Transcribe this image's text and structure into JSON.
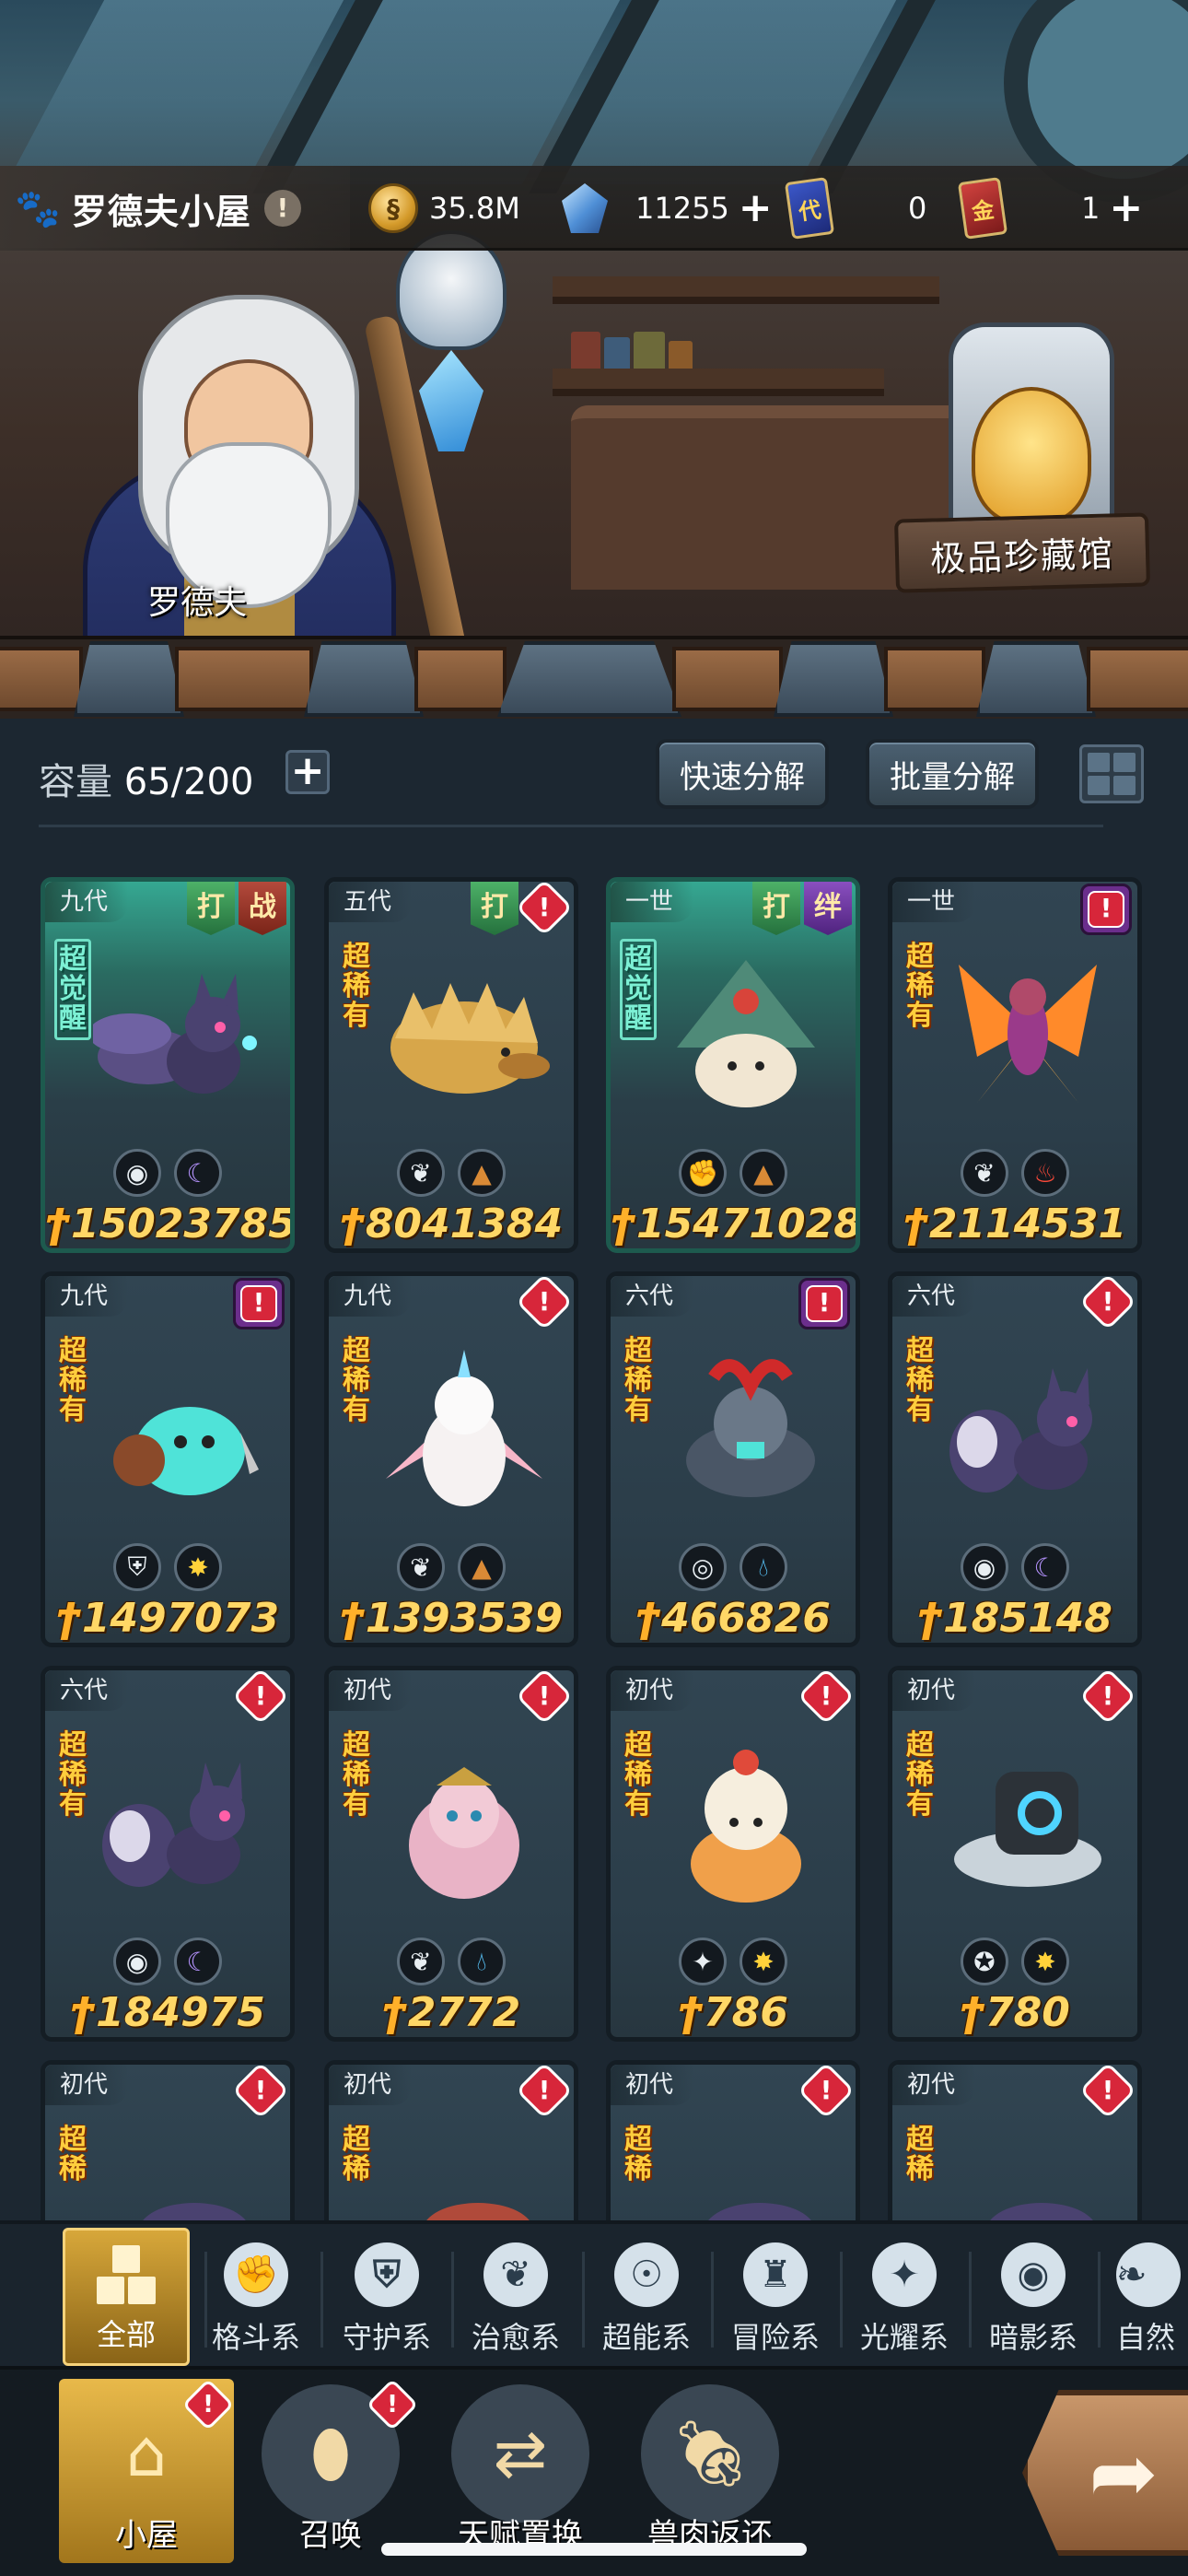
{
  "header": {
    "house_name": "罗德夫小屋",
    "gold": "35.8M",
    "crystals": "11255",
    "card_dai_label": "代",
    "card_dai_count": "0",
    "card_jin_label": "金",
    "card_jin_count": "1"
  },
  "scene": {
    "npc_name": "罗德夫",
    "museum_label": "极品珍藏馆"
  },
  "panel": {
    "capacity_label": "容量",
    "capacity_value": "65/200",
    "quick_decompose": "快速分解",
    "batch_decompose": "批量分解"
  },
  "cards": [
    {
      "gen": "九代",
      "tags": [
        "打",
        "战"
      ],
      "side": "超觉醒",
      "power": "15023785"
    },
    {
      "gen": "五代",
      "tags": [
        "打"
      ],
      "side": "超稀有",
      "power": "8041384"
    },
    {
      "gen": "一世",
      "tags": [
        "打",
        "绊"
      ],
      "side": "超觉醒",
      "power": "15471028"
    },
    {
      "gen": "一世",
      "tags": [],
      "side": "超稀有",
      "power": "2114531"
    },
    {
      "gen": "九代",
      "tags": [],
      "side": "超稀有",
      "power": "1497073"
    },
    {
      "gen": "九代",
      "tags": [],
      "side": "超稀有",
      "power": "1393539"
    },
    {
      "gen": "六代",
      "tags": [],
      "side": "超稀有",
      "power": "466826"
    },
    {
      "gen": "六代",
      "tags": [],
      "side": "超稀有",
      "power": "185148"
    },
    {
      "gen": "六代",
      "tags": [],
      "side": "超稀有",
      "power": "184975"
    },
    {
      "gen": "初代",
      "tags": [],
      "side": "超稀有",
      "power": "2772"
    },
    {
      "gen": "初代",
      "tags": [],
      "side": "超稀有",
      "power": "786"
    },
    {
      "gen": "初代",
      "tags": [],
      "side": "超稀有",
      "power": "780"
    },
    {
      "gen": "初代",
      "tags": [],
      "side": "超稀",
      "power": ""
    },
    {
      "gen": "初代",
      "tags": [],
      "side": "超稀",
      "power": ""
    },
    {
      "gen": "初代",
      "tags": [],
      "side": "超稀",
      "power": ""
    },
    {
      "gen": "初代",
      "tags": [],
      "side": "超稀",
      "power": ""
    }
  ],
  "categories": [
    "全部",
    "格斗系",
    "守护系",
    "治愈系",
    "超能系",
    "冒险系",
    "光耀系",
    "暗影系",
    "自然"
  ],
  "nav": [
    "小屋",
    "召唤",
    "天赋置换",
    "兽肉返还"
  ],
  "icons": {
    "paw": "paw-icon",
    "coin": "gold-coin-icon",
    "crystal": "crystal-icon",
    "alert": "alert-icon",
    "plus": "plus-icon",
    "grid": "grid-view-icon",
    "arrow": "arrow-icon"
  },
  "colors": {
    "accent_gold": "#ffd766",
    "alert_red": "#d7263a",
    "awake_green": "#35a892",
    "panel_bg": "#1c2731"
  }
}
